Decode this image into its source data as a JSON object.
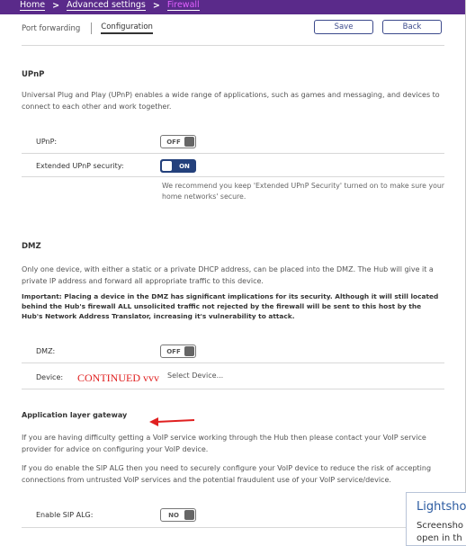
{
  "breadcrumb": {
    "home": "Home",
    "advanced": "Advanced settings",
    "current": "Firewall",
    "separator": ">"
  },
  "tabs": {
    "port_forwarding": "Port forwarding",
    "configuration": "Configuration"
  },
  "buttons": {
    "save": "Save",
    "back": "Back"
  },
  "upnp": {
    "title": "UPnP",
    "description": "Universal Plug and Play (UPnP) enables a wide range of applications, such as games and messaging, and devices to connect to each other and work together.",
    "upnp_label": "UPnP:",
    "upnp_state": "OFF",
    "extended_label": "Extended UPnP security:",
    "extended_state": "ON",
    "recommendation": "We recommend you keep 'Extended UPnP Security' turned on to make sure your home networks' secure."
  },
  "dmz": {
    "title": "DMZ",
    "description": "Only one device, with either a static or a private DHCP address, can be placed into the DMZ. The Hub will give it a private IP address and forward all appropriate traffic to this device.",
    "important": "Important: Placing a device in the DMZ has significant implications for its security. Although it will still located behind the Hub's firewall ALL unsolicited traffic not rejected by the firewall will be sent to this host by the Hub's Network Address Translator, increasing it's vulnerability to attack.",
    "dmz_label": "DMZ:",
    "dmz_state": "OFF",
    "device_label": "Device:",
    "device_value": "Select Device...",
    "annotation": "CONTINUED vvv"
  },
  "alg": {
    "title": "Application layer gateway",
    "p1": "If you are having difficulty getting a VoIP service working through the Hub then please contact your VoIP service provider for advice on configuring your VoIP device.",
    "p2": "If you do enable the SIP ALG then you need to securely configure your VoIP device to reduce the risk of accepting connections from untrusted VoIP services and the potential fraudulent use of your VoIP service/device.",
    "sip_label": "Enable SIP ALG:",
    "sip_state": "NO"
  },
  "lightshot": {
    "title": "Lightsho",
    "line1": "Screensho",
    "line2": "open in th"
  },
  "colors": {
    "brand": "#5a2a8a",
    "accent": "#24417c",
    "annotation": "#e02020"
  }
}
